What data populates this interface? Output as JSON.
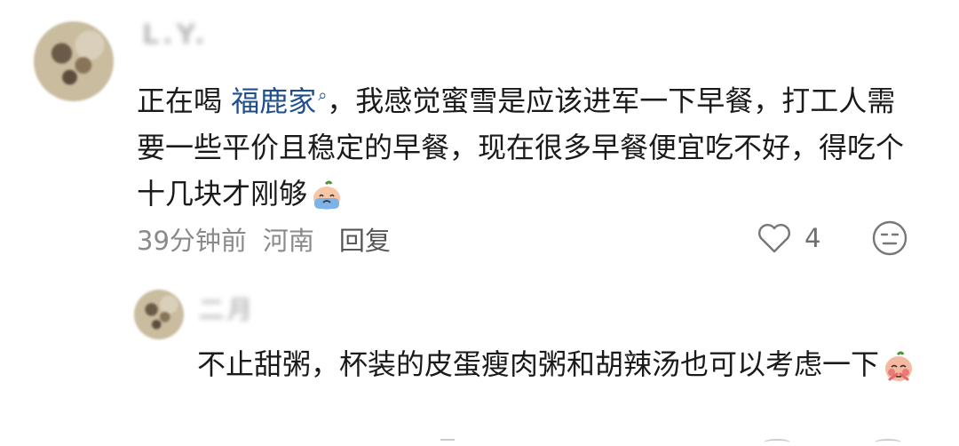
{
  "comments": [
    {
      "username": "L.Y.",
      "text_before": "正在喝 ",
      "mention": "福鹿家",
      "text_after": "，我感觉蜜雪是应该进军一下早餐，打工人需要一些平价且稳定的早餐，现在很多早餐便宜吃不好，得吃个十几块才刚够",
      "emoji": "crying-emoji",
      "time": "39分钟前",
      "location": "河南",
      "reply_label": "回复",
      "likes": "4",
      "like_icon": "heart-icon",
      "dislike_icon": "dislike-face-icon",
      "replies": [
        {
          "username": "二月",
          "text": "不止甜粥，杯装的皮蛋瘦肉粥和胡辣汤也可以考虑一下",
          "emoji": "pleading-emoji"
        }
      ]
    }
  ],
  "colors": {
    "mention": "#1f4f8f",
    "text": "#1a1a1a",
    "meta": "#8a8a8a"
  }
}
